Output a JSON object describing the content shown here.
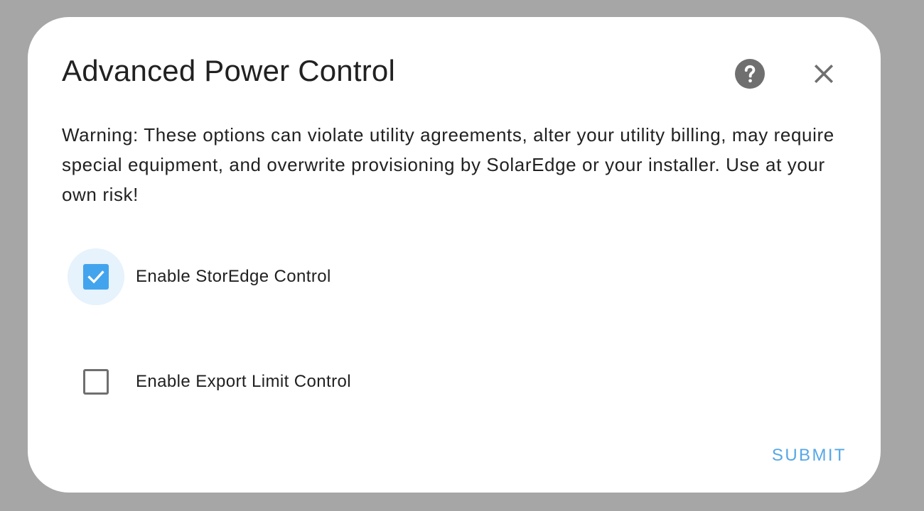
{
  "dialog": {
    "title": "Advanced Power Control",
    "help_icon": "help-circle-icon",
    "close_icon": "close-icon",
    "warning_text": "Warning: These options can violate utility agreements, alter your utility billing, may require special equipment, and overwrite provisioning by SolarEdge or your installer. Use at your own risk!",
    "options": [
      {
        "label": "Enable StorEdge Control",
        "checked": true
      },
      {
        "label": "Enable Export Limit Control",
        "checked": false
      }
    ],
    "submit_label": "SUBMIT"
  },
  "colors": {
    "overlay": "#a6a6a6",
    "accent": "#43a4ee",
    "icon": "#6f6f6f",
    "text": "#212121",
    "submit": "#56a7e6"
  }
}
